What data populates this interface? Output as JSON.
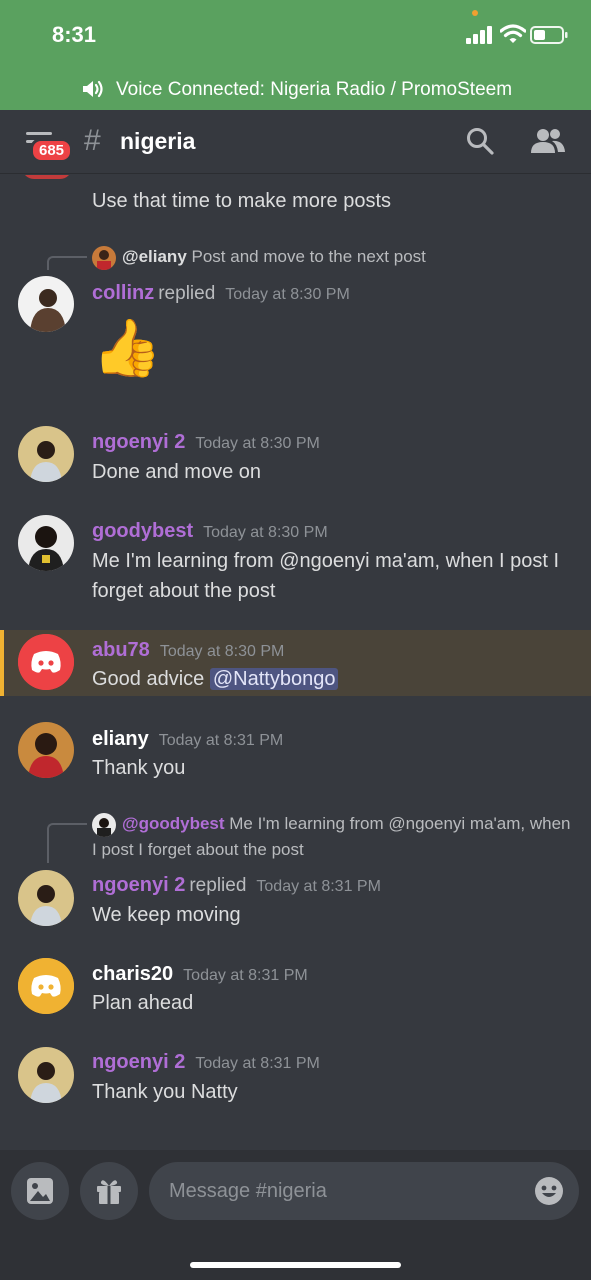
{
  "status_bar": {
    "time": "8:31"
  },
  "voice_bar": {
    "text": "Voice Connected: Nigeria Radio / PromoSteem"
  },
  "header": {
    "badge_count": "685",
    "hash": "#",
    "channel_name": "nigeria"
  },
  "messages": {
    "partial": {
      "text": "Use that time to make more posts"
    },
    "m1": {
      "reply_to_name": "@eliany",
      "reply_to_text": "Post and move to the next post",
      "author": "collinz",
      "replied": "replied",
      "timestamp": "Today at 8:30 PM",
      "emoji": "👍"
    },
    "m2": {
      "author": "ngoenyi 2",
      "timestamp": "Today at 8:30 PM",
      "text": "Done and move on"
    },
    "m3": {
      "author": "goodybest",
      "timestamp": "Today at 8:30 PM",
      "text": "Me I'm learning from @ngoenyi ma'am, when I post I forget about the post"
    },
    "m4": {
      "author": "abu78",
      "timestamp": "Today at 8:30 PM",
      "text_before": "Good advice ",
      "mention": "@Nattybongo"
    },
    "m5": {
      "author": "eliany",
      "timestamp": "Today at 8:31 PM",
      "text": "Thank you"
    },
    "m6": {
      "reply_to_name": "@goodybest",
      "reply_to_text": "Me I'm learning from @ngoenyi ma'am, when I post I forget about the post",
      "author": "ngoenyi 2",
      "replied": "replied",
      "timestamp": "Today at 8:31 PM",
      "text": "We keep moving"
    },
    "m7": {
      "author": "charis20",
      "timestamp": "Today at 8:31 PM",
      "text": "Plan ahead"
    },
    "m8": {
      "author": "ngoenyi 2",
      "timestamp": "Today at 8:31 PM",
      "text": "Thank you Natty"
    }
  },
  "composer": {
    "placeholder": "Message #nigeria"
  },
  "colors": {
    "voice_green": "#5aa15f",
    "background": "#36393f",
    "username_purple": "#b06ed6",
    "highlight_gold": "#f0b232",
    "discord_red": "#ed4245",
    "discord_yellow": "#f0b232"
  },
  "icons": [
    "signal-icon",
    "wifi-icon",
    "battery-icon",
    "speaker-icon",
    "menu-icon",
    "search-icon",
    "members-icon",
    "image-icon",
    "gift-icon",
    "emoji-icon",
    "discord-logo-icon"
  ]
}
